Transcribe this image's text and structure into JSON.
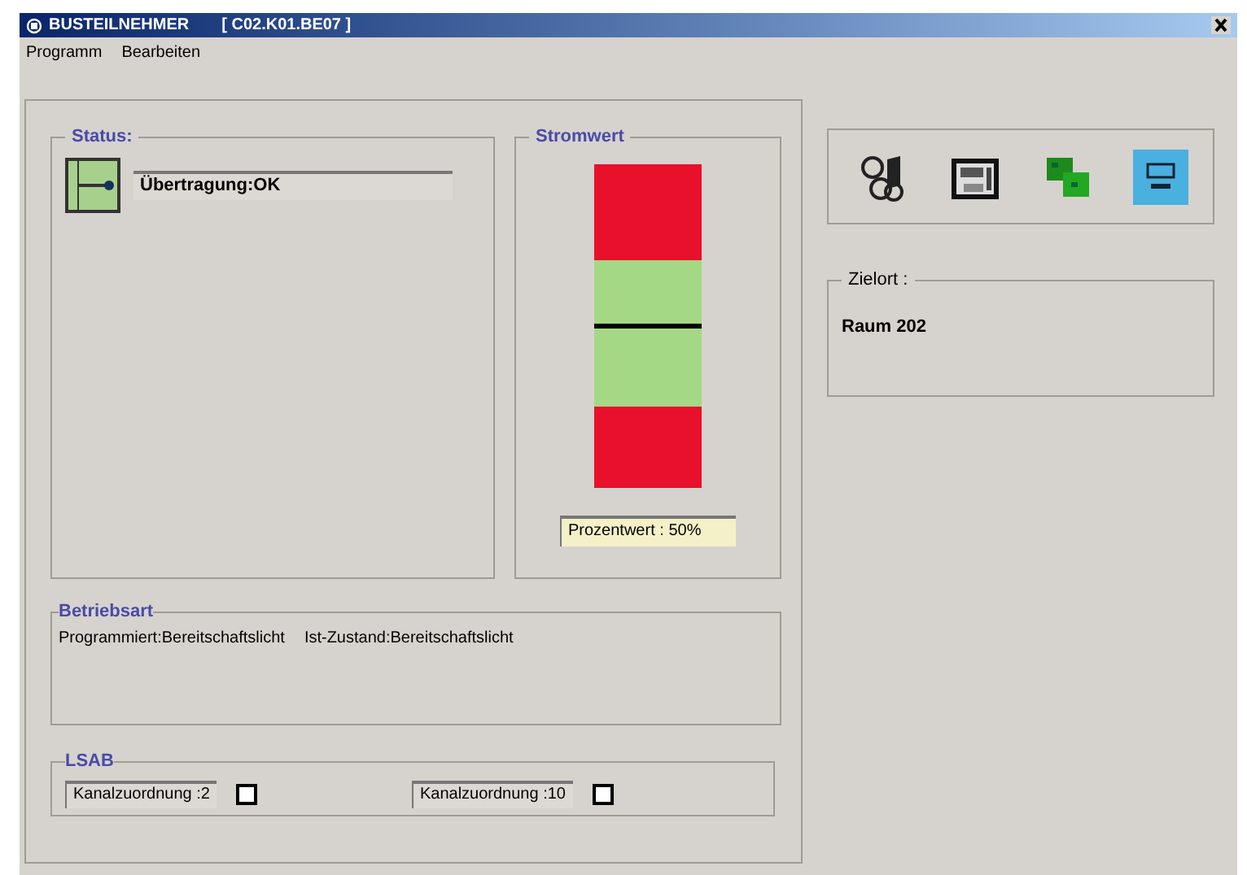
{
  "window": {
    "title": "BUSTEILNEHMER",
    "address": "[ C02.K01.BE07 ]"
  },
  "menu": [
    "Programm",
    "Bearbeiten"
  ],
  "status": {
    "label": "Status:",
    "value": "Übertragung:OK"
  },
  "stromwert": {
    "label": "Stromwert",
    "level": 0.5,
    "reading": "Prozentwert : 50%"
  },
  "betriebsart": {
    "label": "Betriebsart",
    "programmiert": "Programmiert:Bereitschaftslicht",
    "ist_zustand": "Ist-Zustand:Bereitschaftslicht"
  },
  "lsab": {
    "label": "LSAB",
    "channels": [
      {
        "label": "Kanalzuordnung :2",
        "checked": false
      },
      {
        "label": "Kanalzuordnung :10",
        "checked": false
      }
    ]
  },
  "toolbar": [
    {
      "kind": "devices",
      "selected": false
    },
    {
      "kind": "panel",
      "selected": false
    },
    {
      "kind": "boards",
      "selected": false
    },
    {
      "kind": "module",
      "selected": true
    }
  ],
  "zielort": {
    "label": "Zielort :",
    "value": "Raum 202"
  }
}
